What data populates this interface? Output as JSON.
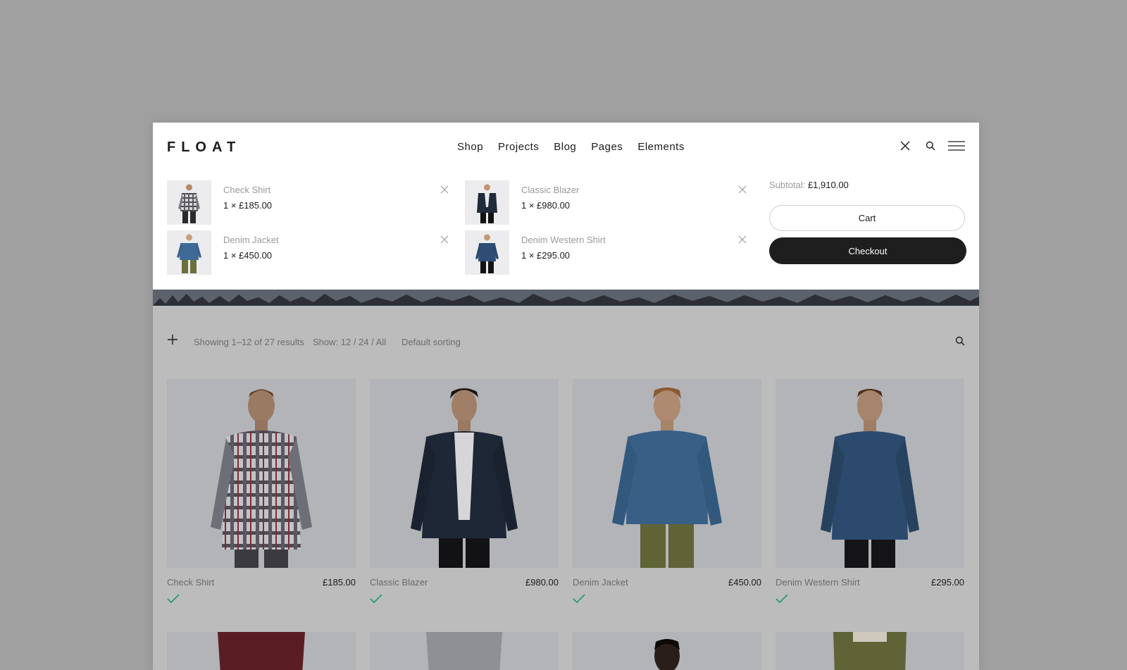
{
  "logo": "FLOAT",
  "nav": [
    "Shop",
    "Projects",
    "Blog",
    "Pages",
    "Elements"
  ],
  "cart": {
    "items": [
      {
        "name": "Check Shirt",
        "qty": "1 × £185.00"
      },
      {
        "name": "Classic Blazer",
        "qty": "1 × £980.00"
      },
      {
        "name": "Denim Jacket",
        "qty": "1 × £450.00"
      },
      {
        "name": "Denim Western Shirt",
        "qty": "1 × £295.00"
      }
    ],
    "subtotal_label": "Subtotal:",
    "subtotal_value": "£1,910.00",
    "cart_button": "Cart",
    "checkout_button": "Checkout"
  },
  "toolbar": {
    "results": "Showing 1–12 of 27 results",
    "show": "Show: 12 / 24 / All",
    "sorting": "Default sorting"
  },
  "products": [
    {
      "name": "Check Shirt",
      "price": "£185.00"
    },
    {
      "name": "Classic Blazer",
      "price": "£980.00"
    },
    {
      "name": "Denim Jacket",
      "price": "£450.00"
    },
    {
      "name": "Denim Western Shirt",
      "price": "£295.00"
    }
  ],
  "icons": {
    "close": "close-icon",
    "search": "search-icon",
    "menu": "hamburger-menu-icon",
    "remove": "remove-x-icon",
    "filter": "plus-icon",
    "added": "checkmark-icon"
  },
  "colors": {
    "accent_check": "#2b9b6e",
    "checkout_bg": "#1e1e1e",
    "backdrop": "#a0a0a0"
  }
}
